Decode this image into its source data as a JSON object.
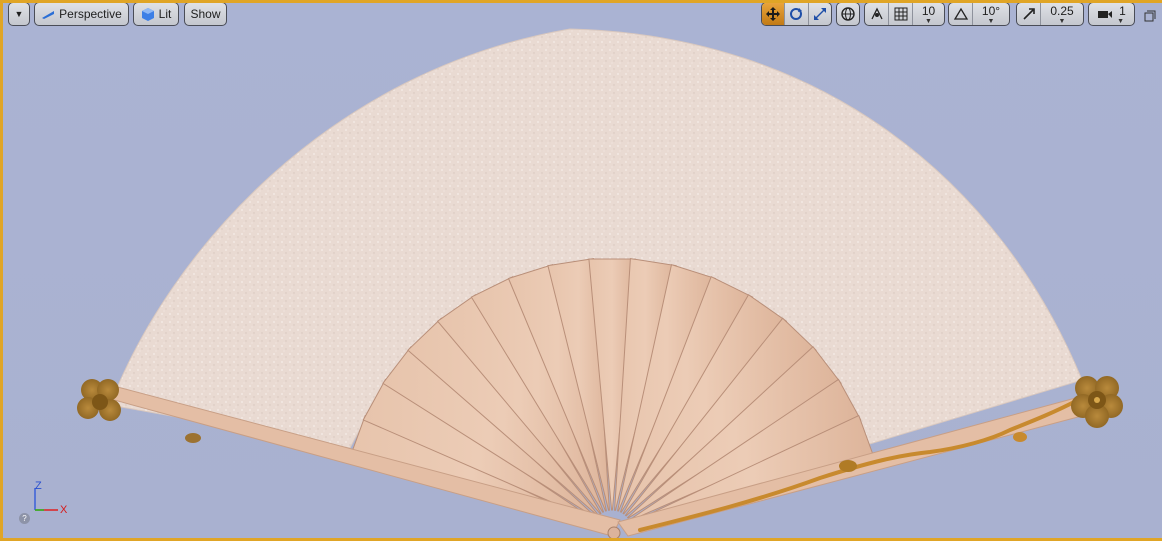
{
  "toolbar": {
    "left": {
      "menu_icon": "chevron-down-icon",
      "perspective_label": "Perspective",
      "lit_label": "Lit",
      "show_label": "Show"
    },
    "right": {
      "grid_snap_value": "10",
      "rotation_snap_value": "10°",
      "scale_snap_value": "0.25",
      "camera_speed_value": "1"
    }
  },
  "axis_gizmo": {
    "z_label": "Z",
    "x_label": "X"
  },
  "help_label": "?",
  "colors": {
    "viewport_bg": "#aab3d3",
    "selection_border": "#e0a526",
    "active_tool": "#e9a43a",
    "fan_paper": "#e8d8d0",
    "fan_wood": "#e3bda3",
    "gold": "#c88a2e"
  }
}
